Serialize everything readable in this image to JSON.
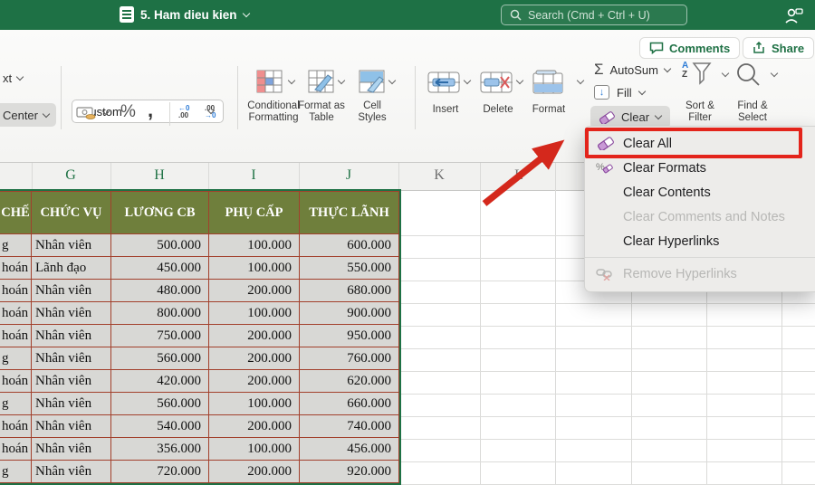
{
  "titlebar": {
    "doc_title": "5. Ham dieu kien",
    "search_placeholder": "Search (Cmd + Ctrl + U)"
  },
  "topbar": {
    "comments": "Comments",
    "share": "Share"
  },
  "ribbon": {
    "wrap_text_partial": "xt",
    "merge_center_partial": "Center",
    "number_format_value": "Custom",
    "conditional_formatting": "Conditional Formatting",
    "format_as_table": "Format as Table",
    "cell_styles": "Cell Styles",
    "insert": "Insert",
    "delete": "Delete",
    "format": "Format",
    "autosum": "AutoSum",
    "fill": "Fill",
    "clear": "Clear",
    "sort_filter": "Sort & Filter",
    "find_select": "Find & Select",
    "glyphs": {
      "sigma": "Σ",
      "percent": "%",
      "comma": ",",
      "fill_arrow": "↓",
      "dec_top": "←0",
      "dec_bottom": ".00",
      "inc_top": ".00",
      "inc_bottom": "→0",
      "sort_a": "A",
      "sort_z": "Z"
    }
  },
  "menu": {
    "items": [
      {
        "label": "Clear All",
        "icon": "eraser-icon",
        "disabled": false,
        "highlighted": true
      },
      {
        "label": "Clear Formats",
        "icon": "clear-formats-icon",
        "disabled": false
      },
      {
        "label": "Clear Contents",
        "icon": null,
        "disabled": false
      },
      {
        "label": "Clear Comments and Notes",
        "icon": null,
        "disabled": true
      },
      {
        "label": "Clear Hyperlinks",
        "icon": null,
        "disabled": false
      },
      {
        "label": "Remove Hyperlinks",
        "icon": "broken-link-icon",
        "disabled": true,
        "separator_before": true
      }
    ]
  },
  "sheet": {
    "column_letters": [
      {
        "label": "G",
        "selected": true
      },
      {
        "label": "H",
        "selected": true
      },
      {
        "label": "I",
        "selected": true
      },
      {
        "label": "J",
        "selected": true
      },
      {
        "label": "K",
        "selected": false
      },
      {
        "label": "L",
        "selected": false
      }
    ],
    "table": {
      "headers": [
        "CHẾ",
        "CHỨC VỤ",
        "LƯƠNG CB",
        "PHỤ CẤP",
        "THỰC LÃNH"
      ],
      "rows": [
        [
          "g",
          "Nhân viên",
          "500.000",
          "100.000",
          "600.000"
        ],
        [
          "hoán",
          "Lãnh đạo",
          "450.000",
          "100.000",
          "550.000"
        ],
        [
          "hoán",
          "Nhân viên",
          "480.000",
          "200.000",
          "680.000"
        ],
        [
          "hoán",
          "Nhân viên",
          "800.000",
          "100.000",
          "900.000"
        ],
        [
          "hoán",
          "Nhân viên",
          "750.000",
          "200.000",
          "950.000"
        ],
        [
          "g",
          "Nhân viên",
          "560.000",
          "200.000",
          "760.000"
        ],
        [
          "hoán",
          "Nhân viên",
          "420.000",
          "200.000",
          "620.000"
        ],
        [
          "g",
          "Nhân viên",
          "560.000",
          "100.000",
          "660.000"
        ],
        [
          "hoán",
          "Nhân viên",
          "540.000",
          "200.000",
          "740.000"
        ],
        [
          "hoán",
          "Nhân viên",
          "356.000",
          "100.000",
          "456.000"
        ],
        [
          "g",
          "Nhân viên",
          "720.000",
          "200.000",
          "920.000"
        ]
      ]
    }
  },
  "colors": {
    "excel_green": "#1e7145",
    "table_header_olive": "#6f7f3c",
    "table_border_red": "#a2402c",
    "annotation_red": "#e3241b"
  }
}
